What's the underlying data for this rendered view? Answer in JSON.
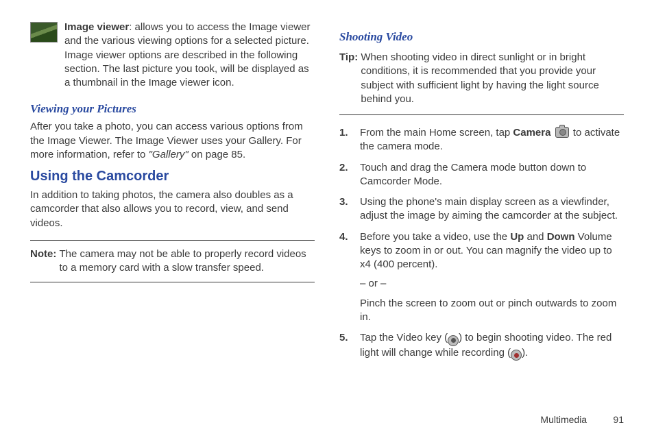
{
  "left": {
    "feature": {
      "title": "Image viewer",
      "text": ": allows you to access the Image viewer and the various viewing options for a selected picture. Image viewer options are described in the following section. The last picture you took, will be displayed as a thumbnail in the Image viewer icon."
    },
    "viewing": {
      "heading": "Viewing your Pictures",
      "para_a": "After you take a photo, you can access various options from the Image Viewer. The Image Viewer uses your Gallery. For more information, refer to ",
      "para_ref": "\"Gallery\" ",
      "para_b": " on page 85."
    },
    "camcorder": {
      "heading": "Using the Camcorder",
      "para": "In addition to taking photos, the camera also doubles as a camcorder that also allows you to record, view, and send videos."
    },
    "note": {
      "label": "Note: ",
      "text": "The camera may not be able to properly record videos to a memory card with a slow transfer speed."
    }
  },
  "right": {
    "heading": "Shooting Video",
    "tip": {
      "label": "Tip: ",
      "text": "When shooting video in direct sunlight or in bright conditions, it is recommended that you provide your subject with sufficient light by having the light source behind you."
    },
    "steps": {
      "s1": {
        "num": "1.",
        "a": "From the main Home screen, tap ",
        "b": "Camera",
        "c": "  to activate the camera mode."
      },
      "s2": {
        "num": "2.",
        "text": "Touch and drag the Camera mode button down to Camcorder Mode."
      },
      "s3": {
        "num": "3.",
        "text": "Using the phone's main display screen as a viewfinder, adjust the image by aiming the camcorder at the subject."
      },
      "s4": {
        "num": "4.",
        "a": "Before you take a video, use the ",
        "up": "Up",
        "mid": " and ",
        "down": "Down",
        "b": " Volume keys to zoom in or out. You can magnify the video up to x4 (400 percent).",
        "or": "– or –",
        "pinch": "Pinch the screen to zoom out or pinch outwards to zoom in."
      },
      "s5": {
        "num": "5.",
        "a": "Tap the Video key (",
        "b": ") to begin shooting video. The red light will change while recording (",
        "c": ")."
      }
    }
  },
  "footer": {
    "section": "Multimedia",
    "page": "91"
  }
}
